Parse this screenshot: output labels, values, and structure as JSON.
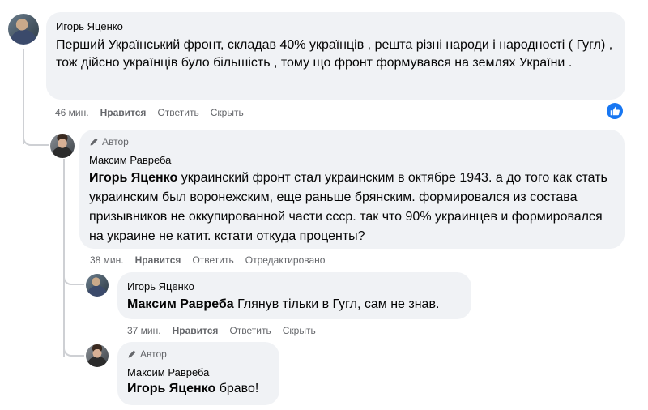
{
  "comments": [
    {
      "author": "Игорь Яценко",
      "text": "Перший Український фронт, складав 40% українців , решта різні народи і народності ( Гугл) , тож дійсно українців було більшість , тому що фронт формувався на землях України .",
      "time": "46 мин.",
      "actions": [
        "Нравится",
        "Ответить",
        "Скрыть"
      ],
      "reaction": "like-icon"
    },
    {
      "author_badge": "Автор",
      "author": "Максим Равреба",
      "mention": "Игорь Яценко",
      "text": " украинский фронт стал украинским в октябре 1943. а до того как стать украинским был воронежским, еще раньше брянским. формировался из состава призывников не оккупированной части ссср. так что 90% украинцев и формировался на украине не катит. кстати откуда проценты?",
      "time": "38 мин.",
      "actions": [
        "Нравится",
        "Ответить",
        "Отредактировано"
      ]
    },
    {
      "author": "Игорь Яценко",
      "mention": "Максим Равреба",
      "text": " Глянув тільки в Гугл, сам не знав.",
      "time": "37 мин.",
      "actions": [
        "Нравится",
        "Ответить",
        "Скрыть"
      ]
    },
    {
      "author_badge": "Автор",
      "author": "Максим Равреба",
      "mention": "Игорь Яценко",
      "text": " браво!"
    }
  ],
  "colors": {
    "bubble": "#f0f2f5",
    "meta": "#65676b",
    "thread": "#ced0d4",
    "like_blue": "#1877f2"
  }
}
